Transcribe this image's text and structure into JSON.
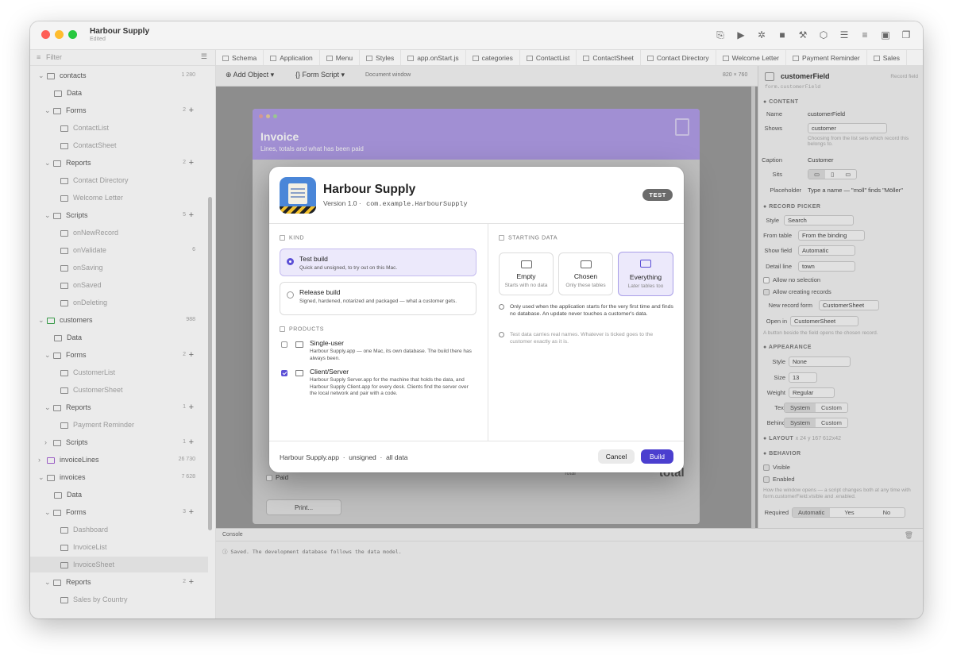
{
  "window": {
    "title": "Harbour Supply",
    "subtitle": "Edited"
  },
  "sidebar": {
    "filter_placeholder": "Filter",
    "rows": [
      {
        "label": "contacts",
        "count": "1 280"
      },
      {
        "label": "Data"
      },
      {
        "label": "Forms",
        "count": "2"
      },
      {
        "label": "ContactList"
      },
      {
        "label": "ContactSheet"
      },
      {
        "label": "Reports",
        "count": "2"
      },
      {
        "label": "Contact Directory"
      },
      {
        "label": "Welcome Letter"
      },
      {
        "label": "Scripts",
        "count": "5"
      },
      {
        "label": "onNewRecord"
      },
      {
        "label": "onValidate",
        "count": "6"
      },
      {
        "label": "onSaving"
      },
      {
        "label": "onSaved"
      },
      {
        "label": "onDeleting"
      },
      {
        "label": "customers",
        "count": "988"
      },
      {
        "label": "Data"
      },
      {
        "label": "Forms",
        "count": "2"
      },
      {
        "label": "CustomerList"
      },
      {
        "label": "CustomerSheet"
      },
      {
        "label": "Reports",
        "count": "1"
      },
      {
        "label": "Payment Reminder"
      },
      {
        "label": "Scripts",
        "count": "1"
      },
      {
        "label": "invoiceLines",
        "count": "26 730"
      },
      {
        "label": "invoices",
        "count": "7 628"
      },
      {
        "label": "Data"
      },
      {
        "label": "Forms",
        "count": "3"
      },
      {
        "label": "Dashboard"
      },
      {
        "label": "InvoiceList"
      },
      {
        "label": "InvoiceSheet"
      },
      {
        "label": "Reports",
        "count": "2"
      },
      {
        "label": "Sales by Country"
      }
    ]
  },
  "tabs": [
    "Schema",
    "Application",
    "Menu",
    "Styles",
    "app.onStart.js",
    "categories",
    "ContactList",
    "ContactSheet",
    "Contact Directory",
    "Welcome Letter",
    "Payment Reminder",
    "Sales"
  ],
  "formbar": {
    "add_object": "Add Object",
    "form_script": "Form Script",
    "document_window": "Document window",
    "size": "820 × 760"
  },
  "form_preview": {
    "title": "Invoice",
    "subtitle": "Lines, totals and what has been paid",
    "paid_label": "Paid",
    "total_label": "Total",
    "total_value": "total",
    "print_button": "Print..."
  },
  "console": {
    "title": "Console",
    "line": "Saved. The development database follows the data model."
  },
  "inspector": {
    "field_name": "customerField",
    "field_kind": "Record field",
    "path": "form.customerField",
    "content_header": "CONTENT",
    "name_label": "Name",
    "name_value": "customerField",
    "shows_label": "Shows",
    "shows_value": "customer",
    "shows_hint": "Choosing from the list sets which record this belongs to.",
    "caption_label": "Caption",
    "caption_value": "Customer",
    "sits_label": "Sits",
    "placeholder_label": "Placeholder",
    "placeholder_value": "Type a name — \"moll\" finds \"Möller\"",
    "record_picker_header": "RECORD PICKER",
    "style_label": "Style",
    "style_value": "Search",
    "from_table_label": "From table",
    "from_table_value": "From the binding",
    "show_field_label": "Show field",
    "show_field_value": "Automatic",
    "detail_line_label": "Detail line",
    "detail_line_value": "town",
    "allow_no_selection": "Allow no selection",
    "allow_creating": "Allow creating records",
    "new_record_form_label": "New record form",
    "new_record_form_value": "CustomerSheet",
    "open_in_label": "Open in",
    "open_in_value": "CustomerSheet",
    "open_in_hint": "A button beside the field opens the chosen record.",
    "appearance_header": "APPEARANCE",
    "app_style_label": "Style",
    "app_style_value": "None",
    "size_label": "Size",
    "size_value": "13",
    "weight_label": "Weight",
    "weight_value": "Regular",
    "text_label": "Text",
    "behind_label": "Behind",
    "opt_system": "System",
    "opt_custom": "Custom",
    "layout_header": "LAYOUT",
    "layout_value": "x 24 y 167 612x42",
    "behavior_header": "BEHAVIOR",
    "visible": "Visible",
    "enabled": "Enabled",
    "behavior_hint": "How the window opens — a script changes both at any time with form.customerField.visible and .enabled.",
    "required_label": "Required",
    "opt_automatic": "Automatic",
    "opt_yes": "Yes",
    "opt_no": "No"
  },
  "dialog": {
    "app_name": "Harbour Supply",
    "version": "Version 1.0",
    "bundle_id": "com.example.HarbourSupply",
    "badge": "TEST",
    "kind_header": "KIND",
    "kinds": [
      {
        "title": "Test build",
        "desc": "Quick and unsigned, to try out on this Mac."
      },
      {
        "title": "Release build",
        "desc": "Signed, hardened, notarized and packaged — what a customer gets."
      }
    ],
    "products_header": "PRODUCTS",
    "products": [
      {
        "title": "Single-user",
        "desc": "Harbour Supply.app — one Mac, its own database. The build there has always been.",
        "checked": false
      },
      {
        "title": "Client/Server",
        "desc": "Harbour Supply Server.app for the machine that holds the data, and Harbour Supply Client.app for every desk. Clients find the server over the local network and pair with a code.",
        "checked": true
      }
    ],
    "starting_header": "STARTING DATA",
    "data_options": [
      {
        "title": "Empty",
        "desc": "Starts with no data"
      },
      {
        "title": "Chosen",
        "desc": "Only these tables"
      },
      {
        "title": "Everything",
        "desc": "Later tables too"
      }
    ],
    "note1": "Only used when the application starts for the very first time and finds no database. An update never touches a customer's data.",
    "note2": "Test data carries real names. Whatever is ticked goes to the customer exactly as it is.",
    "footer_app": "Harbour Supply.app",
    "footer_sign": "unsigned",
    "footer_data": "all data",
    "cancel": "Cancel",
    "build": "Build"
  },
  "colors": {
    "accent": "#4b3fcf",
    "form_header": "#b09ce8",
    "selected_bg": "#ece9fb"
  }
}
